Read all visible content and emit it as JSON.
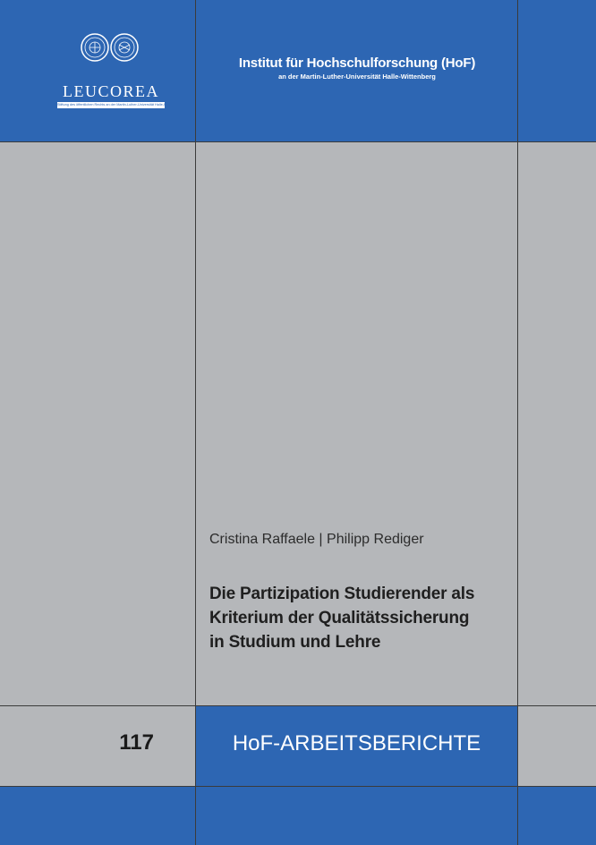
{
  "header": {
    "institute_name": "Institut für Hochschulforschung (HoF)",
    "institute_subtitle": "an der Martin-Luther-Universität Halle-Wittenberg",
    "logo_text": "LEUCOREA",
    "logo_tagline": "Stiftung des öffentlichen Rechts an der Martin-Luther-Universität Halle-Wittenberg"
  },
  "cover": {
    "authors": "Cristina Raffaele | Philipp Rediger",
    "title_lines": [
      "Die Partizipation Studierender als",
      "Kriterium der Qualitätssicherung",
      "in Studium und Lehre"
    ]
  },
  "series": {
    "number": "117",
    "name": "HoF-ARBEITSBERICHTE"
  },
  "colors": {
    "blue": "#2d66b3",
    "gray": "#b5b7ba",
    "lines": "#3b3b3b"
  }
}
